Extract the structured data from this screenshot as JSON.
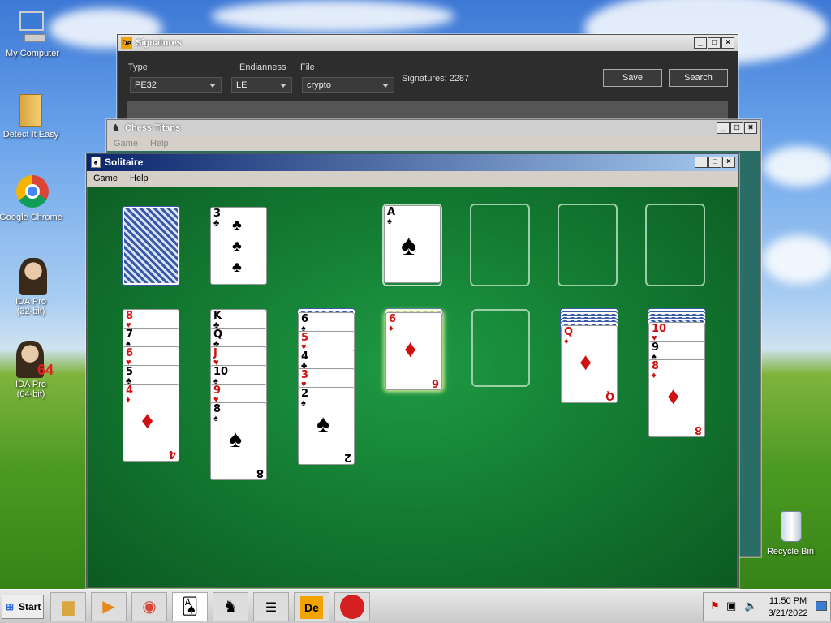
{
  "desktop": {
    "icons": [
      {
        "label": "My Computer"
      },
      {
        "label": "Detect It Easy"
      },
      {
        "label": "Google Chrome"
      },
      {
        "label": "IDA Pro\n(32-bit)"
      },
      {
        "label": "IDA Pro\n(64-bit)"
      },
      {
        "label": "Recycle Bin"
      }
    ]
  },
  "signatures": {
    "title": "Signatures",
    "type_label": "Type",
    "type_value": "PE32",
    "endian_label": "Endianness",
    "endian_value": "LE",
    "file_label": "File",
    "file_value": "crypto",
    "count": "Signatures: 2287",
    "save": "Save",
    "search": "Search"
  },
  "chess": {
    "title": "Chess Titans",
    "menu": [
      "Game",
      "Help"
    ]
  },
  "solitaire": {
    "title": "Solitaire",
    "menu": [
      "Game",
      "Help"
    ],
    "waste_top": {
      "rank": "3",
      "suit": "♣"
    },
    "foundation": [
      {
        "rank": "A",
        "suit": "♠"
      }
    ],
    "columns": [
      [
        "8♥",
        "7♠",
        "6♥",
        "5♣",
        "4♦"
      ],
      [
        "K♣",
        "Q♣",
        "J♥",
        "10♠",
        "9♥",
        "8♠"
      ],
      [
        "6♠",
        "5♥",
        "4♣",
        "3♥",
        "2♠"
      ],
      [
        "6♦"
      ],
      [],
      [
        "Q♦"
      ],
      [
        "10♥",
        "9♠",
        "8♦"
      ]
    ]
  },
  "taskbar": {
    "start": "Start",
    "time": "11:50 PM",
    "date": "3/21/2022"
  },
  "colors": {
    "felt": "#137a31",
    "title_active": "#0a246a"
  }
}
